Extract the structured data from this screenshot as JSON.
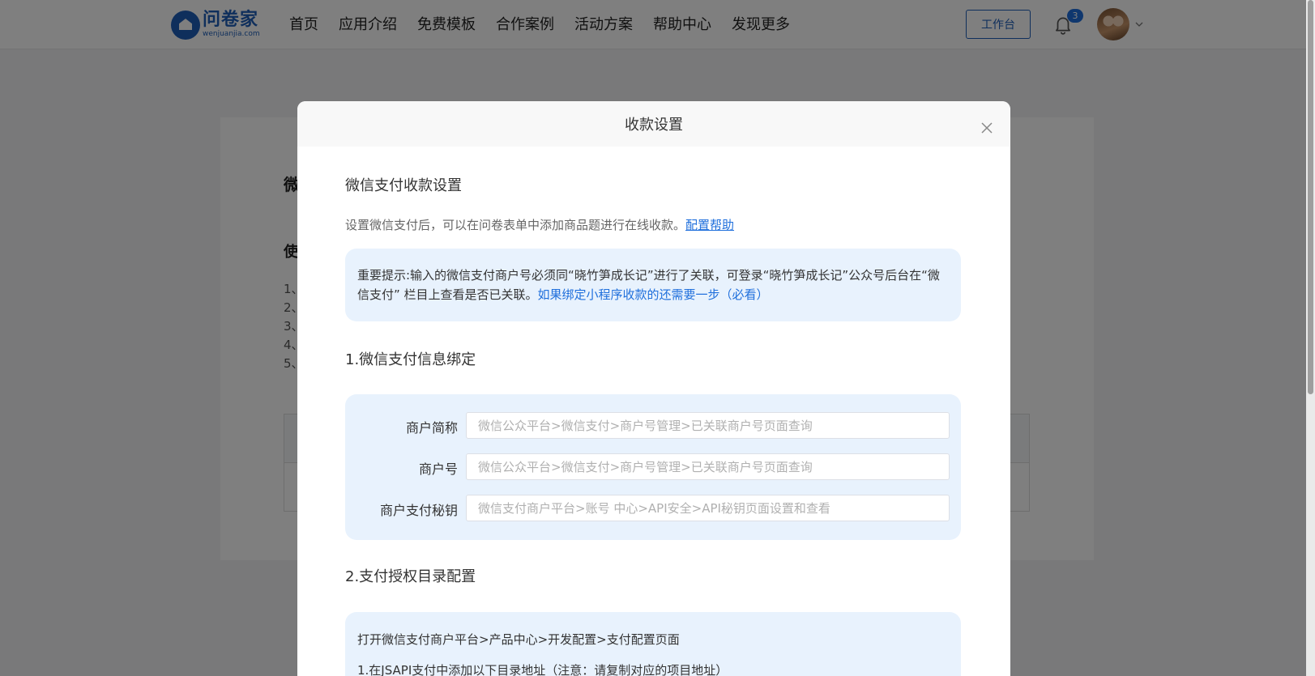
{
  "header": {
    "logo_cn": "问卷家",
    "logo_en": "wenjuanjia.com",
    "nav": [
      "首页",
      "应用介绍",
      "免费模板",
      "合作案例",
      "活动方案",
      "帮助中心",
      "发现更多"
    ],
    "workbench_label": "工作台",
    "notification_count": "3"
  },
  "background_page": {
    "title": "微",
    "subtitle": "使",
    "list": [
      "1、",
      "2、",
      "3、",
      "4、",
      "5、"
    ]
  },
  "modal": {
    "title": "收款设置",
    "section_title": "微信支付收款设置",
    "description": "设置微信支付后，可以在问卷表单中添加商品题进行在线收款。",
    "help_link": "配置帮助",
    "notice_text": "重要提示:输入的微信支付商户号必须同“晓竹笋成长记”进行了关联，可登录“晓竹笋成长记”公众号后台在“微信支付” 栏目上查看是否已关联。",
    "notice_link": "如果绑定小程序收款的还需要一步（必看）",
    "step1_title": "1.微信支付信息绑定",
    "fields": [
      {
        "label": "商户简称",
        "value": "",
        "placeholder": "微信公众平台>微信支付>商户号管理>已关联商户号页面查询"
      },
      {
        "label": "商户号",
        "value": "",
        "placeholder": "微信公众平台>微信支付>商户号管理>已关联商户号页面查询"
      },
      {
        "label": "商户支付秘钥",
        "value": "",
        "placeholder": "微信支付商户平台>账号 中心>API安全>API秘钥页面设置和查看"
      }
    ],
    "step2_title": "2.支付授权目录配置",
    "step2_line1": "打开微信支付商户平台>产品中心>开发配置>支付配置页面",
    "step2_line2": "1.在JSAPI支付中添加以下目录地址（注意：请复制对应的项目地址）"
  },
  "colors": {
    "brand": "#1f5fb9",
    "link": "#1f6fdc",
    "panel": "#e8f2fd"
  }
}
